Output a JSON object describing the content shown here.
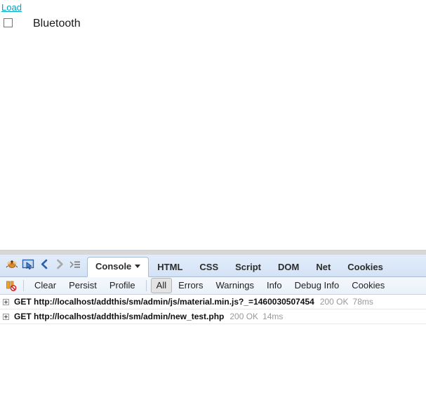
{
  "page": {
    "load_link_label": "Load",
    "checkbox_checked": false,
    "checkbox_label": "Bluetooth"
  },
  "firebug": {
    "toolbar_icons": [
      {
        "name": "firebug-logo-icon",
        "title": "Firebug"
      },
      {
        "name": "inspect-element-icon",
        "title": "Inspect Element"
      },
      {
        "name": "back-arrow-icon",
        "title": "Back"
      },
      {
        "name": "forward-arrow-icon",
        "title": "Forward"
      },
      {
        "name": "quick-info-icon",
        "title": "Quick Info"
      }
    ],
    "tabs": [
      {
        "label": "Console",
        "active": true,
        "has_caret": true
      },
      {
        "label": "HTML",
        "active": false,
        "has_caret": false
      },
      {
        "label": "CSS",
        "active": false,
        "has_caret": false
      },
      {
        "label": "Script",
        "active": false,
        "has_caret": false
      },
      {
        "label": "DOM",
        "active": false,
        "has_caret": false
      },
      {
        "label": "Net",
        "active": false,
        "has_caret": false
      },
      {
        "label": "Cookies",
        "active": false,
        "has_caret": false
      }
    ],
    "sub_toolbar": {
      "break_on_error_icon": "break-on-error-icon",
      "actions": [
        {
          "label": "Clear",
          "active": false
        },
        {
          "label": "Persist",
          "active": false
        },
        {
          "label": "Profile",
          "active": false
        }
      ],
      "filters": [
        {
          "label": "All",
          "active": true
        },
        {
          "label": "Errors",
          "active": false
        },
        {
          "label": "Warnings",
          "active": false
        },
        {
          "label": "Info",
          "active": false
        },
        {
          "label": "Debug Info",
          "active": false
        },
        {
          "label": "Cookies",
          "active": false
        }
      ]
    },
    "console_rows": [
      {
        "request": "GET http://localhost/addthis/sm/admin/js/material.min.js?_=1460030507454",
        "status": "200 OK",
        "time": "78ms"
      },
      {
        "request": "GET http://localhost/addthis/sm/admin/new_test.php",
        "status": "200 OK",
        "time": "14ms"
      }
    ]
  },
  "colors": {
    "link": "#00a5c4",
    "tabbar_top": "#e2edfa",
    "tabbar_bottom": "#d3e2f5",
    "tab_border": "#a9bcd2",
    "status_text": "#9a9a9a",
    "splitter": "#d7d7d7"
  }
}
